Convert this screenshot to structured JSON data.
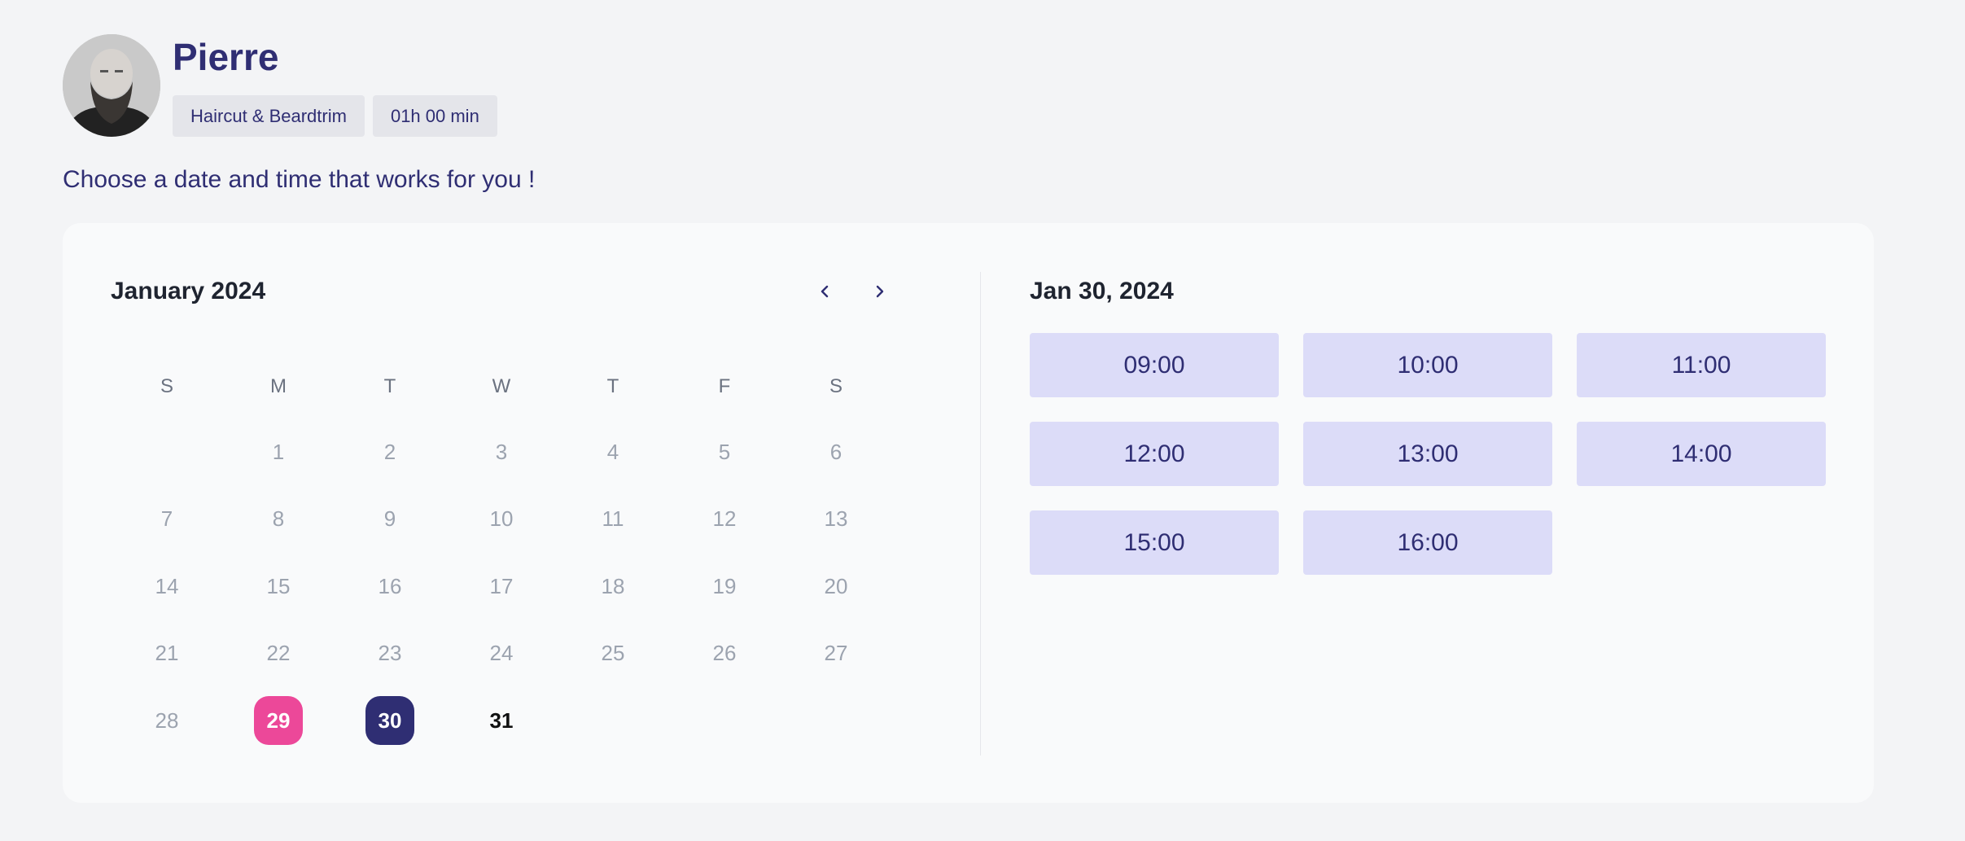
{
  "provider": {
    "name": "Pierre",
    "tags": [
      "Haircut & Beardtrim",
      "01h 00 min"
    ]
  },
  "instruction": "Choose a date and time that works for you !",
  "calendar": {
    "month_label": "January 2024",
    "weekdays": [
      "S",
      "M",
      "T",
      "W",
      "T",
      "F",
      "S"
    ],
    "days": [
      "1",
      "2",
      "3",
      "4",
      "5",
      "6",
      "7",
      "8",
      "9",
      "10",
      "11",
      "12",
      "13",
      "14",
      "15",
      "16",
      "17",
      "18",
      "19",
      "20",
      "21",
      "22",
      "23",
      "24",
      "25",
      "26",
      "27",
      "28",
      "29",
      "30",
      "31"
    ],
    "first_weekday_index": 1,
    "today": "29",
    "selected": "30",
    "available": [
      "31"
    ]
  },
  "timeslots": {
    "date_label": "Jan 30, 2024",
    "slots": [
      "09:00",
      "10:00",
      "11:00",
      "12:00",
      "13:00",
      "14:00",
      "15:00",
      "16:00"
    ]
  },
  "colors": {
    "primary": "#2f2e73",
    "today_accent": "#ec4899",
    "slot_bg": "#dcdcf8"
  }
}
